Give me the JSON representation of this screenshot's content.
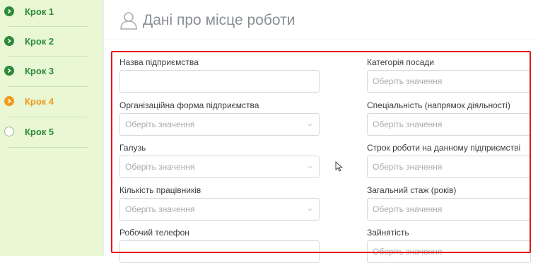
{
  "sidebar": {
    "steps": [
      {
        "label": "Крок 1",
        "state": "done"
      },
      {
        "label": "Крок 2",
        "state": "done"
      },
      {
        "label": "Крок 3",
        "state": "done"
      },
      {
        "label": "Крок 4",
        "state": "current"
      },
      {
        "label": "Крок 5",
        "state": "todo"
      }
    ]
  },
  "header": {
    "title": "Дані про місце роботи",
    "icon": "user-icon"
  },
  "form": {
    "left": [
      {
        "label": "Назва підприємства",
        "type": "text",
        "value": "",
        "placeholder": ""
      },
      {
        "label": "Організаційна форма підприємства",
        "type": "select",
        "placeholder": "Оберіть значення"
      },
      {
        "label": "Галузь",
        "type": "select",
        "placeholder": "Оберіть значення"
      },
      {
        "label": "Кількість працівників",
        "type": "select",
        "placeholder": "Оберіть значення"
      },
      {
        "label": "Робочий телефон",
        "type": "text",
        "value": "",
        "placeholder": ""
      }
    ],
    "right": [
      {
        "label": "Категорія посади",
        "type": "select",
        "placeholder": "Оберіть значення"
      },
      {
        "label": "Спеціальність (напрямок діяльності)",
        "type": "select",
        "placeholder": "Оберіть значення"
      },
      {
        "label": "Строк роботи на данному підприємстві",
        "type": "select",
        "placeholder": "Оберіть значення"
      },
      {
        "label": "Загальний стаж (років)",
        "type": "select",
        "placeholder": "Оберіть значення"
      },
      {
        "label": "Зайнятість",
        "type": "select",
        "placeholder": "Оберіть значення"
      }
    ]
  },
  "colors": {
    "sidebar_bg": "#e9f7d4",
    "step_done": "#2d8a3a",
    "step_current": "#f29a1f",
    "highlight_border": "#e3141b"
  }
}
